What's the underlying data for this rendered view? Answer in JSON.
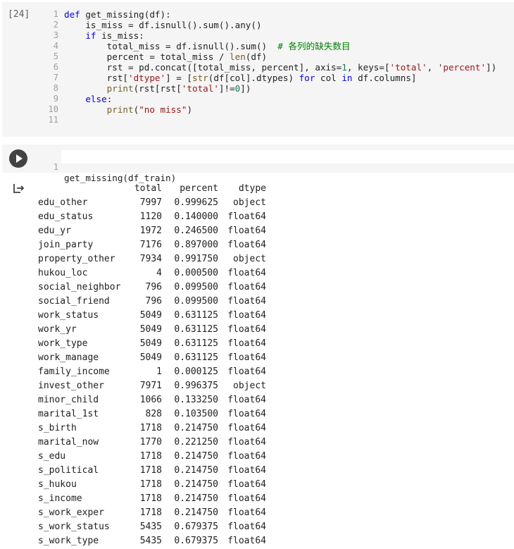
{
  "cell1": {
    "exec_count": "[24]",
    "lines": [
      {
        "n": "1",
        "html": "<span class='kw'>def</span> get_missing(df):"
      },
      {
        "n": "2",
        "html": "    is_miss = df.isnull().sum().any()"
      },
      {
        "n": "3",
        "html": "    <span class='kw'>if</span> is_miss:"
      },
      {
        "n": "4",
        "html": "        total_miss = df.isnull().sum()  <span class='com'># 各列的缺失数目</span>"
      },
      {
        "n": "5",
        "html": "        percent = total_miss / <span class='fn'>len</span>(df)"
      },
      {
        "n": "6",
        "html": "        rst = pd.concat([total_miss, percent], axis=<span class='num'>1</span>, keys=[<span class='str'>'total'</span>, <span class='str'>'percent'</span>])"
      },
      {
        "n": "7",
        "html": "        rst[<span class='str'>'dtype'</span>] = [<span class='fn'>str</span>(df[col].dtypes) <span class='kw'>for</span> col <span class='kw'>in</span> df.columns]"
      },
      {
        "n": "8",
        "html": "        <span class='fn'>print</span>(rst[rst[<span class='str'>'total'</span>]!=<span class='num'>0</span>])"
      },
      {
        "n": "9",
        "html": "    <span class='kw'>else</span>:"
      },
      {
        "n": "10",
        "html": "        <span class='fn'>print</span>(<span class='str'>\"no miss\"</span>)"
      },
      {
        "n": "11",
        "html": ""
      }
    ]
  },
  "cell2": {
    "line_number": "1",
    "code": "get_missing(df_train)"
  },
  "output": {
    "columns": [
      "",
      "total",
      "percent",
      "dtype"
    ],
    "rows": [
      [
        "edu_other",
        "7997",
        "0.999625",
        "object"
      ],
      [
        "edu_status",
        "1120",
        "0.140000",
        "float64"
      ],
      [
        "edu_yr",
        "1972",
        "0.246500",
        "float64"
      ],
      [
        "join_party",
        "7176",
        "0.897000",
        "float64"
      ],
      [
        "property_other",
        "7934",
        "0.991750",
        "object"
      ],
      [
        "hukou_loc",
        "4",
        "0.000500",
        "float64"
      ],
      [
        "social_neighbor",
        "796",
        "0.099500",
        "float64"
      ],
      [
        "social_friend",
        "796",
        "0.099500",
        "float64"
      ],
      [
        "work_status",
        "5049",
        "0.631125",
        "float64"
      ],
      [
        "work_yr",
        "5049",
        "0.631125",
        "float64"
      ],
      [
        "work_type",
        "5049",
        "0.631125",
        "float64"
      ],
      [
        "work_manage",
        "5049",
        "0.631125",
        "float64"
      ],
      [
        "family_income",
        "1",
        "0.000125",
        "float64"
      ],
      [
        "invest_other",
        "7971",
        "0.996375",
        "object"
      ],
      [
        "minor_child",
        "1066",
        "0.133250",
        "float64"
      ],
      [
        "marital_1st",
        "828",
        "0.103500",
        "float64"
      ],
      [
        "s_birth",
        "1718",
        "0.214750",
        "float64"
      ],
      [
        "marital_now",
        "1770",
        "0.221250",
        "float64"
      ],
      [
        "s_edu",
        "1718",
        "0.214750",
        "float64"
      ],
      [
        "s_political",
        "1718",
        "0.214750",
        "float64"
      ],
      [
        "s_hukou",
        "1718",
        "0.214750",
        "float64"
      ],
      [
        "s_income",
        "1718",
        "0.214750",
        "float64"
      ],
      [
        "s_work_exper",
        "1718",
        "0.214750",
        "float64"
      ],
      [
        "s_work_status",
        "5435",
        "0.679375",
        "float64"
      ],
      [
        "s_work_type",
        "5435",
        "0.679375",
        "float64"
      ]
    ]
  },
  "icons": {
    "run": "play-circle-icon",
    "output": "output-redirect-icon"
  }
}
